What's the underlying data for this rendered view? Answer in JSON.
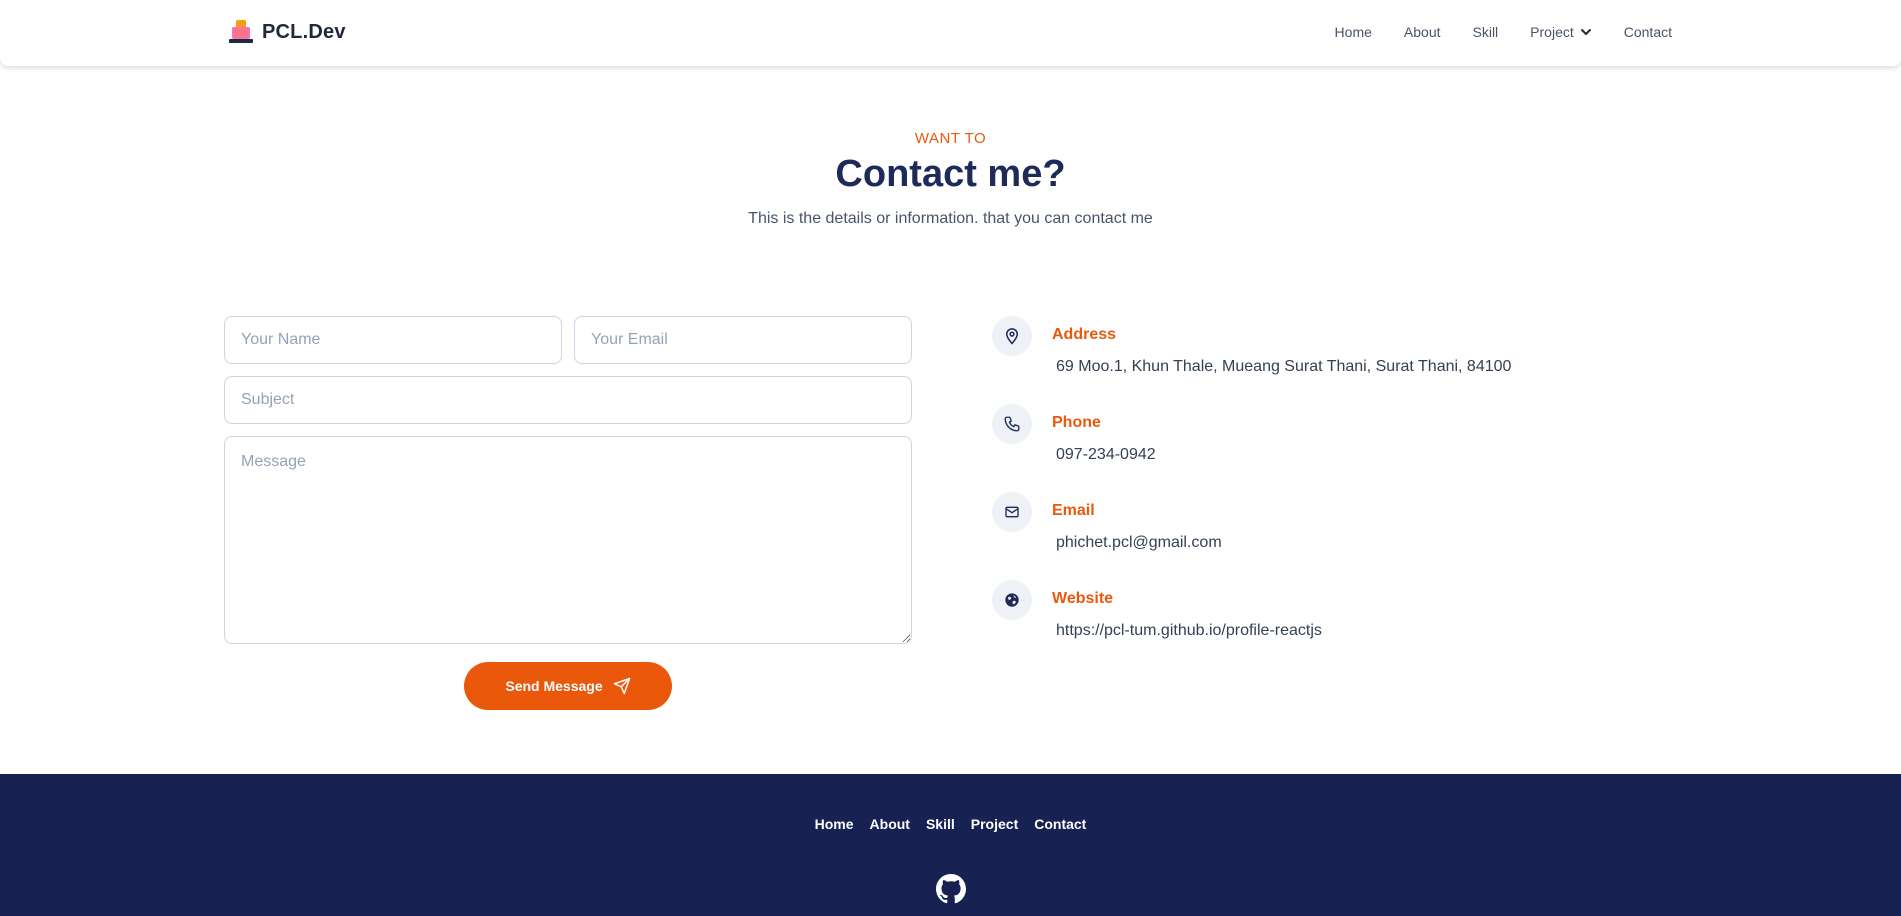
{
  "header": {
    "brand": "PCL.Dev",
    "nav": [
      {
        "label": "Home"
      },
      {
        "label": "About"
      },
      {
        "label": "Skill"
      },
      {
        "label": "Project",
        "icon": "chevron-down-icon"
      },
      {
        "label": "Contact"
      }
    ]
  },
  "hero": {
    "eyebrow": "WANT TO",
    "title": "Contact me?",
    "subtitle": "This is the details or information. that you can contact me"
  },
  "form": {
    "name_placeholder": "Your Name",
    "email_placeholder": "Your Email",
    "subject_placeholder": "Subject",
    "message_placeholder": "Message",
    "send_label": "Send Message",
    "send_icon": "paper-plane-icon"
  },
  "contact": [
    {
      "icon": "map-pin-icon",
      "label": "Address",
      "value": "69 Moo.1, Khun Thale, Mueang Surat Thani, Surat Thani, 84100"
    },
    {
      "icon": "phone-icon",
      "label": "Phone",
      "value": "097-234-0942"
    },
    {
      "icon": "mail-icon",
      "label": "Email",
      "value": "phichet.pcl@gmail.com"
    },
    {
      "icon": "globe-icon",
      "label": "Website",
      "value": "https://pcl-tum.github.io/profile-reactjs"
    }
  ],
  "footer": {
    "nav": [
      "Home",
      "About",
      "Skill",
      "Project",
      "Contact"
    ],
    "social_icon": "github-icon"
  },
  "colors": {
    "accent": "#ea580c",
    "heading": "#1e2a5a",
    "footer_bg": "#172252"
  }
}
